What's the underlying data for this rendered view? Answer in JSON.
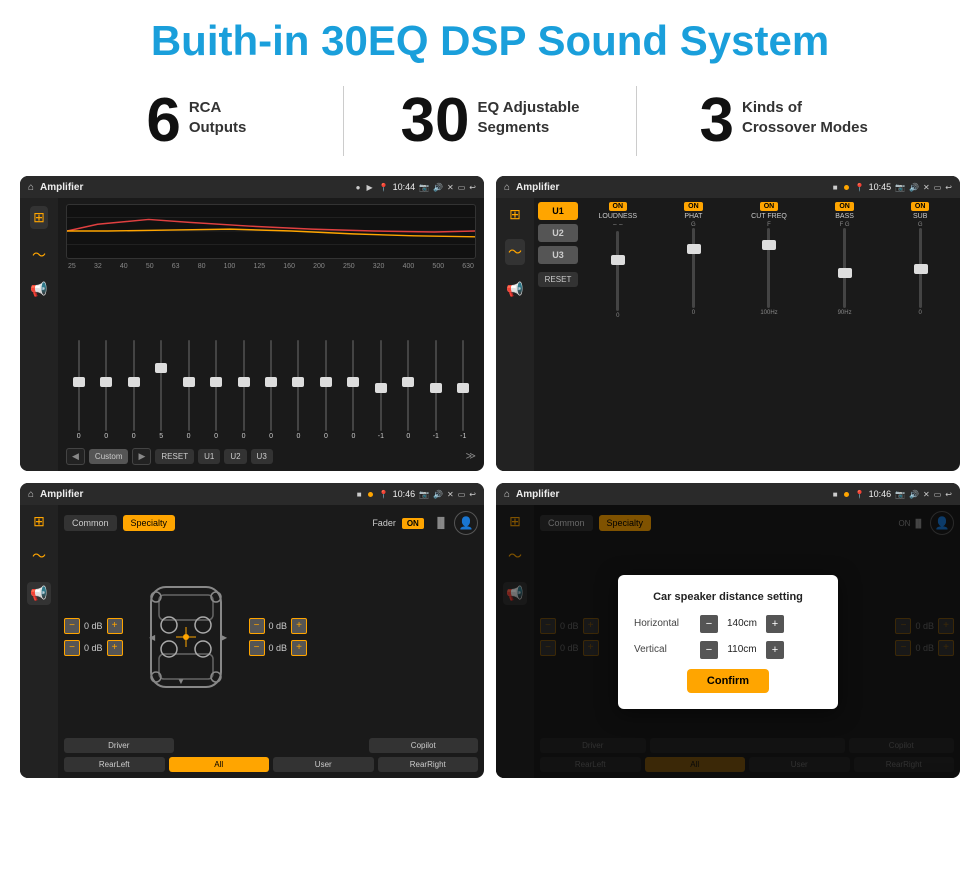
{
  "header": {
    "title": "Buith-in 30EQ DSP Sound System"
  },
  "stats": [
    {
      "number": "6",
      "text_line1": "RCA",
      "text_line2": "Outputs"
    },
    {
      "number": "30",
      "text_line1": "EQ Adjustable",
      "text_line2": "Segments"
    },
    {
      "number": "3",
      "text_line1": "Kinds of",
      "text_line2": "Crossover Modes"
    }
  ],
  "screens": {
    "eq": {
      "title": "Amplifier",
      "time": "10:44",
      "eq_freqs": [
        "25",
        "32",
        "40",
        "50",
        "63",
        "80",
        "100",
        "125",
        "160",
        "200",
        "250",
        "320",
        "400",
        "500",
        "630"
      ],
      "eq_values": [
        "0",
        "0",
        "0",
        "5",
        "0",
        "0",
        "0",
        "0",
        "0",
        "0",
        "0",
        "-1",
        "0",
        "-1"
      ],
      "preset_label": "Custom",
      "buttons": [
        "RESET",
        "U1",
        "U2",
        "U3"
      ]
    },
    "crossover": {
      "title": "Amplifier",
      "time": "10:45",
      "u_buttons": [
        "U1",
        "U2",
        "U3"
      ],
      "channels": [
        {
          "name": "LOUDNESS",
          "on": true
        },
        {
          "name": "PHAT",
          "on": true
        },
        {
          "name": "CUT FREQ",
          "on": true
        },
        {
          "name": "BASS",
          "on": true
        },
        {
          "name": "SUB",
          "on": true
        }
      ],
      "reset_label": "RESET"
    },
    "speaker": {
      "title": "Amplifier",
      "time": "10:46",
      "tabs": [
        "Common",
        "Specialty"
      ],
      "fader_label": "Fader",
      "on_label": "ON",
      "db_values": [
        "0 dB",
        "0 dB",
        "0 dB",
        "0 dB"
      ],
      "bottom_buttons": [
        "Driver",
        "Copilot",
        "RearLeft",
        "All",
        "User",
        "RearRight"
      ]
    },
    "dialog": {
      "title": "Amplifier",
      "time": "10:46",
      "tabs": [
        "Common",
        "Specialty"
      ],
      "dialog_title": "Car speaker distance setting",
      "horizontal_label": "Horizontal",
      "horizontal_value": "140cm",
      "vertical_label": "Vertical",
      "vertical_value": "110cm",
      "confirm_label": "Confirm",
      "db_values": [
        "0 dB",
        "0 dB"
      ],
      "bottom_buttons": [
        "Driver",
        "Copilot",
        "RearLeft",
        "All",
        "User",
        "RearRight"
      ]
    }
  }
}
